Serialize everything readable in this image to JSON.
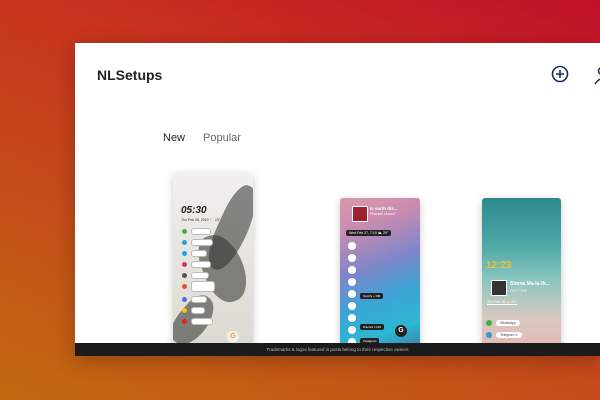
{
  "app": {
    "title": "NLSetups"
  },
  "header": {
    "add_icon": "plus-circle-icon",
    "user_icon": "user-icon"
  },
  "tabs": [
    {
      "label": "New",
      "active": true
    },
    {
      "label": "Popular",
      "active": false
    }
  ],
  "cards": [
    {
      "clock": "05:30",
      "date": "Thu Feb 28, 2019 ⛅ 23°",
      "apps": [
        "WhatsApp",
        "Telegram X",
        "Twitter",
        "Instagram",
        "Gmail",
        "Chrome",
        "Discord",
        "Notes",
        "YouTube"
      ],
      "fab_icon": "google-icon"
    },
    {
      "song": "Is earth dis...",
      "artist": "Pharaoh Monch",
      "date": "Wed Feb 27, 7:19 ⛅ 29°",
      "labels": [
        "Spotify + DM",
        "Discord x DM",
        "Instagram"
      ],
      "fab_icon": "google-icon"
    },
    {
      "clock": "12:23",
      "song": "Shona Ma-la-lh...",
      "artist": "DOG TIME",
      "date": "Thu Feb 28 ⛅ 29°",
      "apps": [
        "WhatsApp",
        "Telegram X"
      ]
    }
  ],
  "footer": {
    "text": "Trademarks & logos featured in posts belong to their respective owners"
  },
  "colors": {
    "accent": "#1a2b5c",
    "clock_yellow": "#f3c12e",
    "footer_bg": "#1b1b1b"
  }
}
